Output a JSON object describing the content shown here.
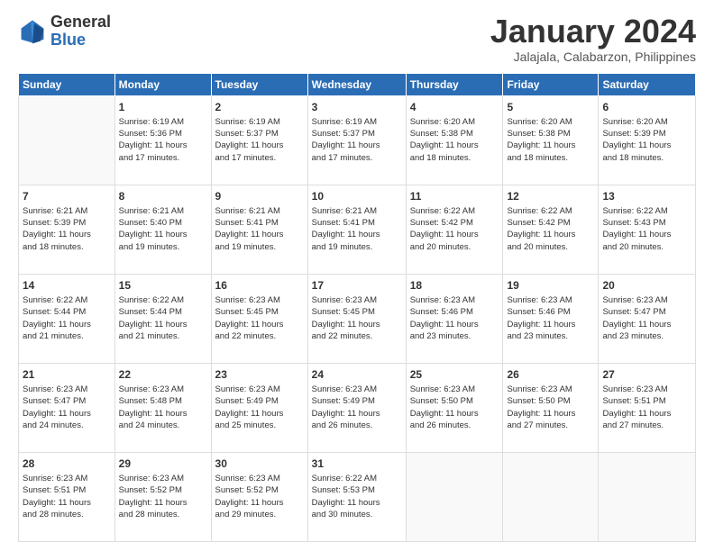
{
  "header": {
    "logo_general": "General",
    "logo_blue": "Blue",
    "month_title": "January 2024",
    "location": "Jalajala, Calabarzon, Philippines"
  },
  "weekdays": [
    "Sunday",
    "Monday",
    "Tuesday",
    "Wednesday",
    "Thursday",
    "Friday",
    "Saturday"
  ],
  "weeks": [
    [
      {
        "day": "",
        "info": ""
      },
      {
        "day": "1",
        "info": "Sunrise: 6:19 AM\nSunset: 5:36 PM\nDaylight: 11 hours\nand 17 minutes."
      },
      {
        "day": "2",
        "info": "Sunrise: 6:19 AM\nSunset: 5:37 PM\nDaylight: 11 hours\nand 17 minutes."
      },
      {
        "day": "3",
        "info": "Sunrise: 6:19 AM\nSunset: 5:37 PM\nDaylight: 11 hours\nand 17 minutes."
      },
      {
        "day": "4",
        "info": "Sunrise: 6:20 AM\nSunset: 5:38 PM\nDaylight: 11 hours\nand 18 minutes."
      },
      {
        "day": "5",
        "info": "Sunrise: 6:20 AM\nSunset: 5:38 PM\nDaylight: 11 hours\nand 18 minutes."
      },
      {
        "day": "6",
        "info": "Sunrise: 6:20 AM\nSunset: 5:39 PM\nDaylight: 11 hours\nand 18 minutes."
      }
    ],
    [
      {
        "day": "7",
        "info": "Sunrise: 6:21 AM\nSunset: 5:39 PM\nDaylight: 11 hours\nand 18 minutes."
      },
      {
        "day": "8",
        "info": "Sunrise: 6:21 AM\nSunset: 5:40 PM\nDaylight: 11 hours\nand 19 minutes."
      },
      {
        "day": "9",
        "info": "Sunrise: 6:21 AM\nSunset: 5:41 PM\nDaylight: 11 hours\nand 19 minutes."
      },
      {
        "day": "10",
        "info": "Sunrise: 6:21 AM\nSunset: 5:41 PM\nDaylight: 11 hours\nand 19 minutes."
      },
      {
        "day": "11",
        "info": "Sunrise: 6:22 AM\nSunset: 5:42 PM\nDaylight: 11 hours\nand 20 minutes."
      },
      {
        "day": "12",
        "info": "Sunrise: 6:22 AM\nSunset: 5:42 PM\nDaylight: 11 hours\nand 20 minutes."
      },
      {
        "day": "13",
        "info": "Sunrise: 6:22 AM\nSunset: 5:43 PM\nDaylight: 11 hours\nand 20 minutes."
      }
    ],
    [
      {
        "day": "14",
        "info": "Sunrise: 6:22 AM\nSunset: 5:44 PM\nDaylight: 11 hours\nand 21 minutes."
      },
      {
        "day": "15",
        "info": "Sunrise: 6:22 AM\nSunset: 5:44 PM\nDaylight: 11 hours\nand 21 minutes."
      },
      {
        "day": "16",
        "info": "Sunrise: 6:23 AM\nSunset: 5:45 PM\nDaylight: 11 hours\nand 22 minutes."
      },
      {
        "day": "17",
        "info": "Sunrise: 6:23 AM\nSunset: 5:45 PM\nDaylight: 11 hours\nand 22 minutes."
      },
      {
        "day": "18",
        "info": "Sunrise: 6:23 AM\nSunset: 5:46 PM\nDaylight: 11 hours\nand 23 minutes."
      },
      {
        "day": "19",
        "info": "Sunrise: 6:23 AM\nSunset: 5:46 PM\nDaylight: 11 hours\nand 23 minutes."
      },
      {
        "day": "20",
        "info": "Sunrise: 6:23 AM\nSunset: 5:47 PM\nDaylight: 11 hours\nand 23 minutes."
      }
    ],
    [
      {
        "day": "21",
        "info": "Sunrise: 6:23 AM\nSunset: 5:47 PM\nDaylight: 11 hours\nand 24 minutes."
      },
      {
        "day": "22",
        "info": "Sunrise: 6:23 AM\nSunset: 5:48 PM\nDaylight: 11 hours\nand 24 minutes."
      },
      {
        "day": "23",
        "info": "Sunrise: 6:23 AM\nSunset: 5:49 PM\nDaylight: 11 hours\nand 25 minutes."
      },
      {
        "day": "24",
        "info": "Sunrise: 6:23 AM\nSunset: 5:49 PM\nDaylight: 11 hours\nand 26 minutes."
      },
      {
        "day": "25",
        "info": "Sunrise: 6:23 AM\nSunset: 5:50 PM\nDaylight: 11 hours\nand 26 minutes."
      },
      {
        "day": "26",
        "info": "Sunrise: 6:23 AM\nSunset: 5:50 PM\nDaylight: 11 hours\nand 27 minutes."
      },
      {
        "day": "27",
        "info": "Sunrise: 6:23 AM\nSunset: 5:51 PM\nDaylight: 11 hours\nand 27 minutes."
      }
    ],
    [
      {
        "day": "28",
        "info": "Sunrise: 6:23 AM\nSunset: 5:51 PM\nDaylight: 11 hours\nand 28 minutes."
      },
      {
        "day": "29",
        "info": "Sunrise: 6:23 AM\nSunset: 5:52 PM\nDaylight: 11 hours\nand 28 minutes."
      },
      {
        "day": "30",
        "info": "Sunrise: 6:23 AM\nSunset: 5:52 PM\nDaylight: 11 hours\nand 29 minutes."
      },
      {
        "day": "31",
        "info": "Sunrise: 6:22 AM\nSunset: 5:53 PM\nDaylight: 11 hours\nand 30 minutes."
      },
      {
        "day": "",
        "info": ""
      },
      {
        "day": "",
        "info": ""
      },
      {
        "day": "",
        "info": ""
      }
    ]
  ]
}
